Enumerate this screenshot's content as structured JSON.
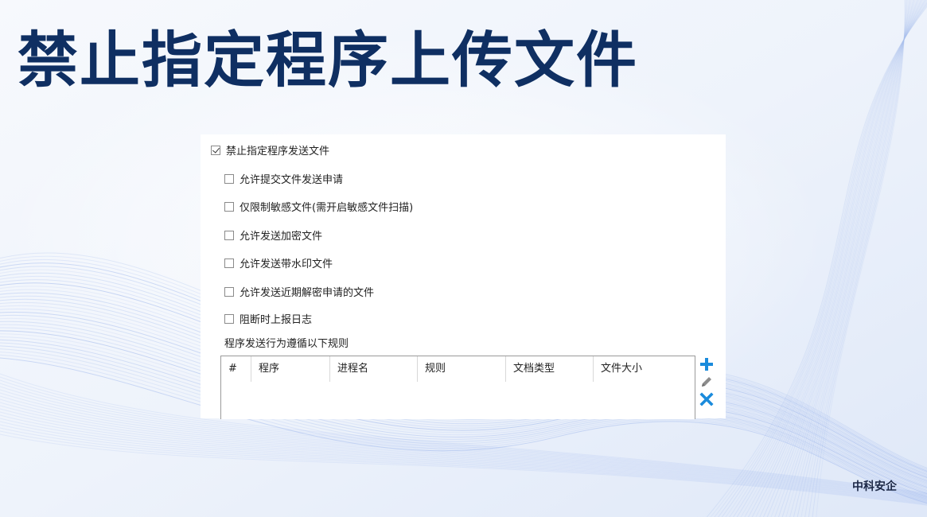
{
  "page": {
    "title": "禁止指定程序上传文件",
    "brand": "中科安企"
  },
  "settings": {
    "main_option": {
      "label": "禁止指定程序发送文件",
      "checked": true
    },
    "sub_options": [
      {
        "label": "允许提交文件发送申请",
        "checked": false
      },
      {
        "label": "仅限制敏感文件(需开启敏感文件扫描)",
        "checked": false
      },
      {
        "label": "允许发送加密文件",
        "checked": false
      },
      {
        "label": "允许发送带水印文件",
        "checked": false
      },
      {
        "label": "允许发送近期解密申请的文件",
        "checked": false
      },
      {
        "label": "阻断时上报日志",
        "checked": false
      }
    ],
    "rules_label": "程序发送行为遵循以下规则"
  },
  "rules_table": {
    "columns": [
      "#",
      "程序",
      "进程名",
      "规则",
      "文档类型",
      "文件大小"
    ],
    "rows": []
  },
  "icons": {
    "add": "plus-icon",
    "edit": "pencil-icon",
    "delete": "close-icon"
  },
  "colors": {
    "title": "#0f2f62",
    "accent": "#1a8bdc"
  }
}
